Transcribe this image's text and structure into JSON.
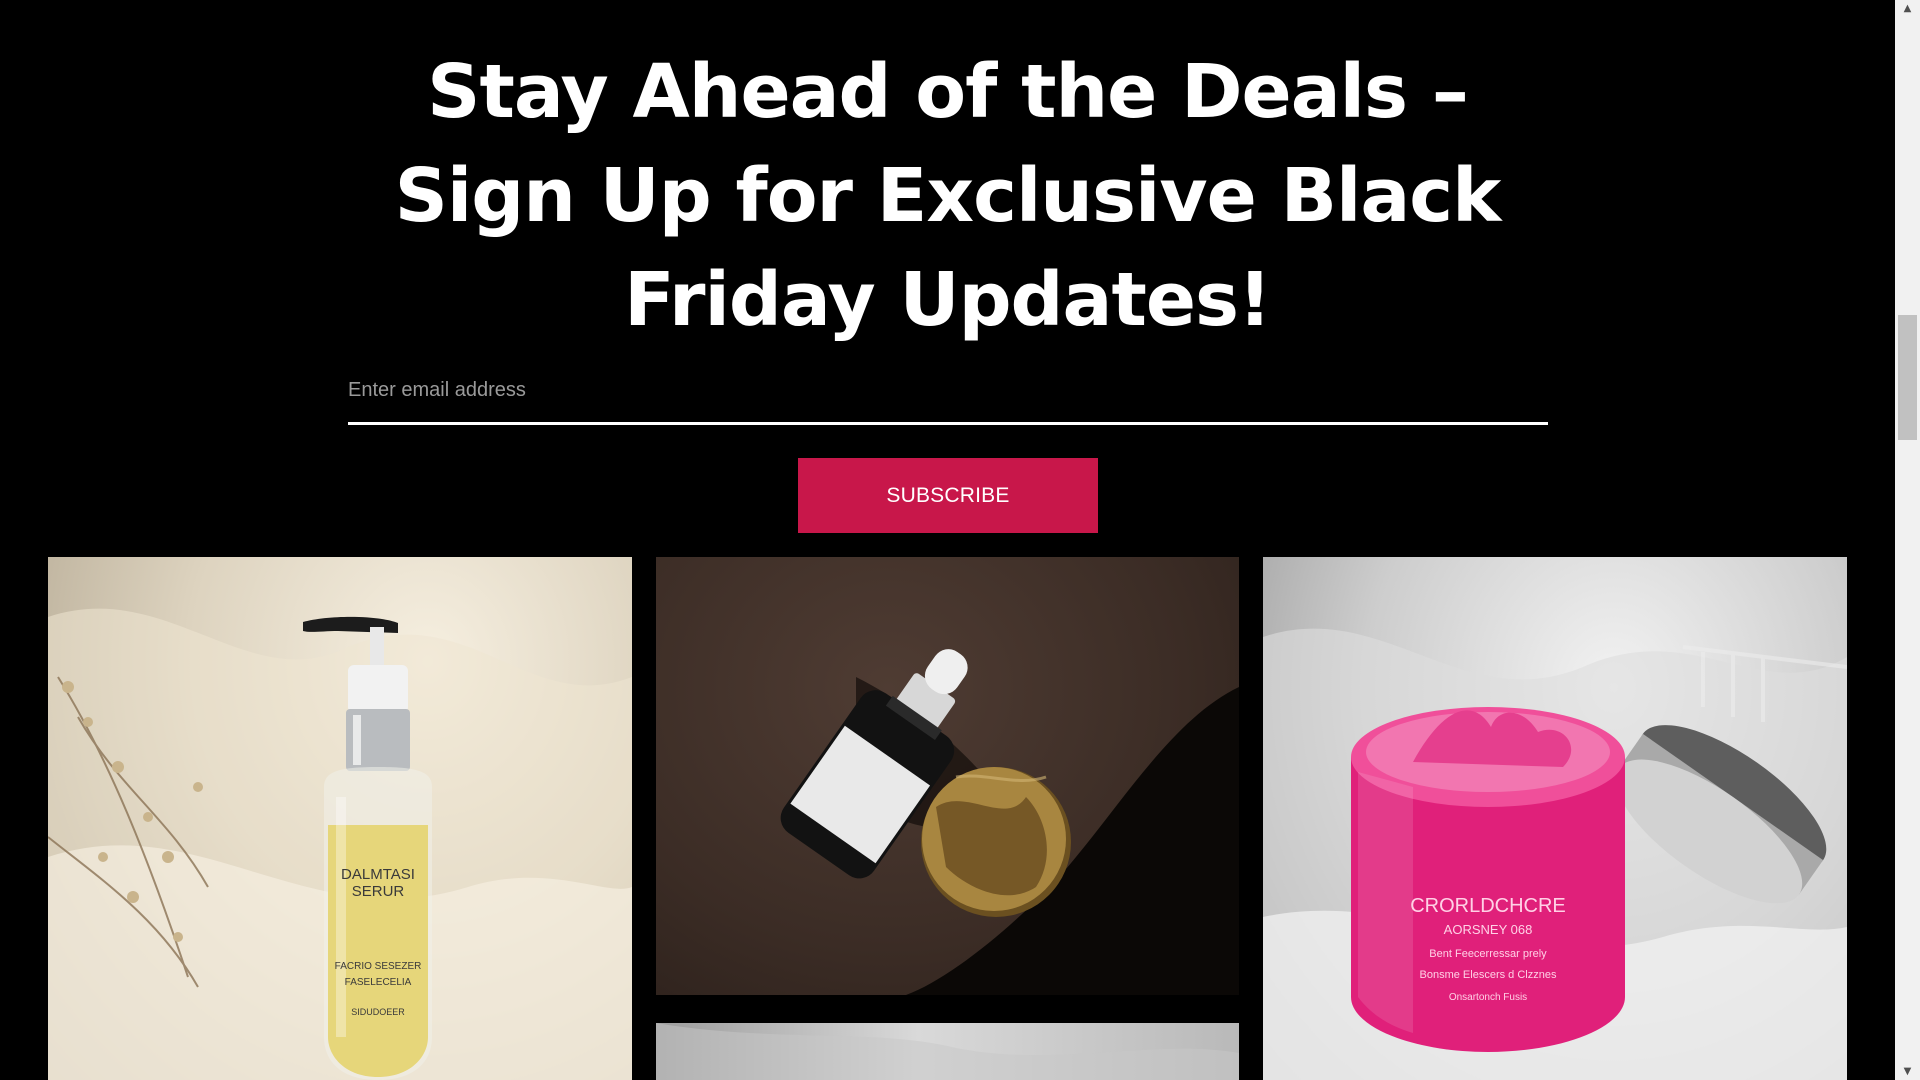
{
  "newsletter": {
    "headline_lines": [
      "Stay Ahead of the Deals –",
      "Sign Up for Exclusive Black",
      "Friday Updates!"
    ],
    "email_placeholder": "Enter email address",
    "email_value": "",
    "subscribe_label": "SUBSCRIBE"
  },
  "gallery": {
    "items": [
      {
        "icon": "serum-pump-bottle-image",
        "label_line1": "DALMTASI",
        "label_line2": "SERUR",
        "label_line3": "FACRIO SESEZER",
        "label_line4": "FASELECELIA",
        "label_line5": "SIDUDOEER"
      },
      {
        "icon": "dropper-bottle-image"
      },
      {
        "icon": "pink-cream-jar-image",
        "label_line1": "CRORLDCHCRE",
        "label_line2": "AORSNEY 068",
        "label_line3": "Bent Feecerressar prely",
        "label_line4": "Bonsme Elescers d Clzznes",
        "label_line5": "Onsartonch Fusis"
      },
      {
        "icon": "product-photo-partial"
      }
    ]
  },
  "colors": {
    "background": "#000000",
    "accent": "#c8174a",
    "text": "#ffffff"
  }
}
